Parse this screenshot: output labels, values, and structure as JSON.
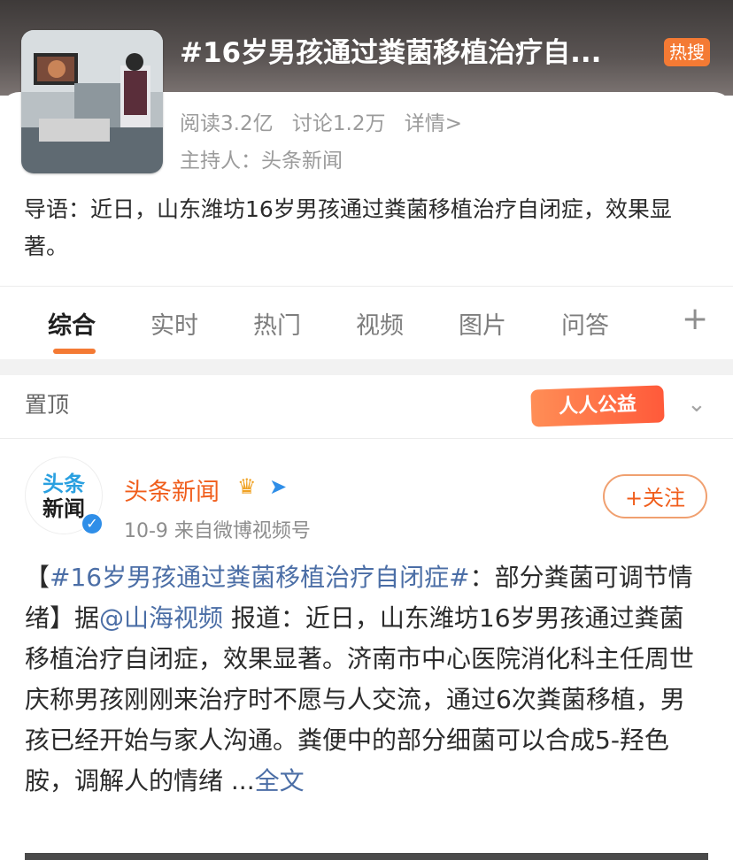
{
  "header": {
    "title": "#16岁男孩通过粪菌移植治疗自...",
    "badge": "热搜",
    "reads": "阅读3.2亿",
    "discuss": "讨论1.2万",
    "detail": "详情>",
    "host_prefix": "主持人：",
    "host_name": "头条新闻"
  },
  "intro": "导语：近日，山东潍坊16岁男孩通过粪菌移植治疗自闭症，效果显著。",
  "tabs": [
    "综合",
    "实时",
    "热门",
    "视频",
    "图片",
    "问答"
  ],
  "tab_plus": "+",
  "pinned": {
    "label": "置顶",
    "charity": "人人公益"
  },
  "post": {
    "avatar_line1": "头条",
    "avatar_line2": "新闻",
    "author": "头条新闻",
    "meta": "10-9  来自微博视频号",
    "follow": "+关注",
    "body_open": "【",
    "hashtag": "#16岁男孩通过粪菌移植治疗自闭症#",
    "body_after_hashtag": "：部分粪菌可调节情绪】据",
    "mention": "@山海视频",
    "body_main": " 报道：近日，山东潍坊16岁男孩通过粪菌移植治疗自闭症，效果显著。济南市中心医院消化科主任周世庆称男孩刚刚来治疗时不愿与人交流，通过6次粪菌移植，男孩已经开始与家人沟通。粪便中的部分细菌可以合成5-羟色胺，调解人的情绪 ...",
    "more": "全文"
  },
  "colors": {
    "accent": "#f47a34",
    "link": "#4b6ea6",
    "author": "#f05e1c"
  },
  "icons": {
    "crown": "crown-icon",
    "plane": "paper-plane-icon",
    "chevron": "chevron-down-icon",
    "verify": "verified-icon"
  }
}
